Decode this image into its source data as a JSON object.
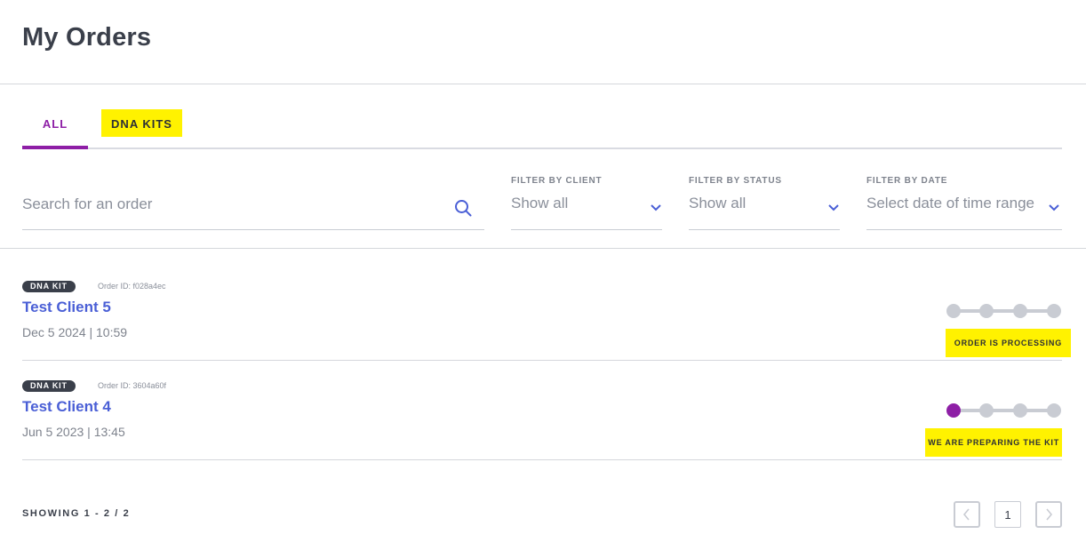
{
  "page": {
    "title": "My Orders"
  },
  "tabs": [
    {
      "label": "ALL",
      "active": true
    },
    {
      "label": "DNA KITS",
      "active": false
    }
  ],
  "search": {
    "placeholder": "Search for an order",
    "value": "",
    "icon": "search-icon"
  },
  "filters": {
    "client": {
      "label": "FILTER BY CLIENT",
      "value": "Show all"
    },
    "status": {
      "label": "FILTER BY STATUS",
      "value": "Show all"
    },
    "date": {
      "label": "FILTER BY DATE",
      "value": "Select date of time range"
    }
  },
  "orders": [
    {
      "badge": "DNA KIT",
      "order_id": "Order ID: f028a4ec",
      "client": "Test Client 5",
      "date": "Dec 5 2024 | 10:59",
      "status": "ORDER IS PROCESSING",
      "progress_step": 0,
      "progress_total": 4
    },
    {
      "badge": "DNA KIT",
      "order_id": "Order ID: 3604a60f",
      "client": "Test Client 4",
      "date": "Jun 5 2023 | 13:45",
      "status": "WE ARE PREPARING THE KIT",
      "progress_step": 1,
      "progress_total": 4
    }
  ],
  "pagination": {
    "showing": "SHOWING 1 - 2 / 2",
    "current_page": "1"
  },
  "colors": {
    "accent": "#8e1fa6",
    "link": "#4a5fd6",
    "highlight": "#fff200",
    "badge_bg": "#3a3f4a",
    "inactive_dot": "#c9ccd3"
  }
}
